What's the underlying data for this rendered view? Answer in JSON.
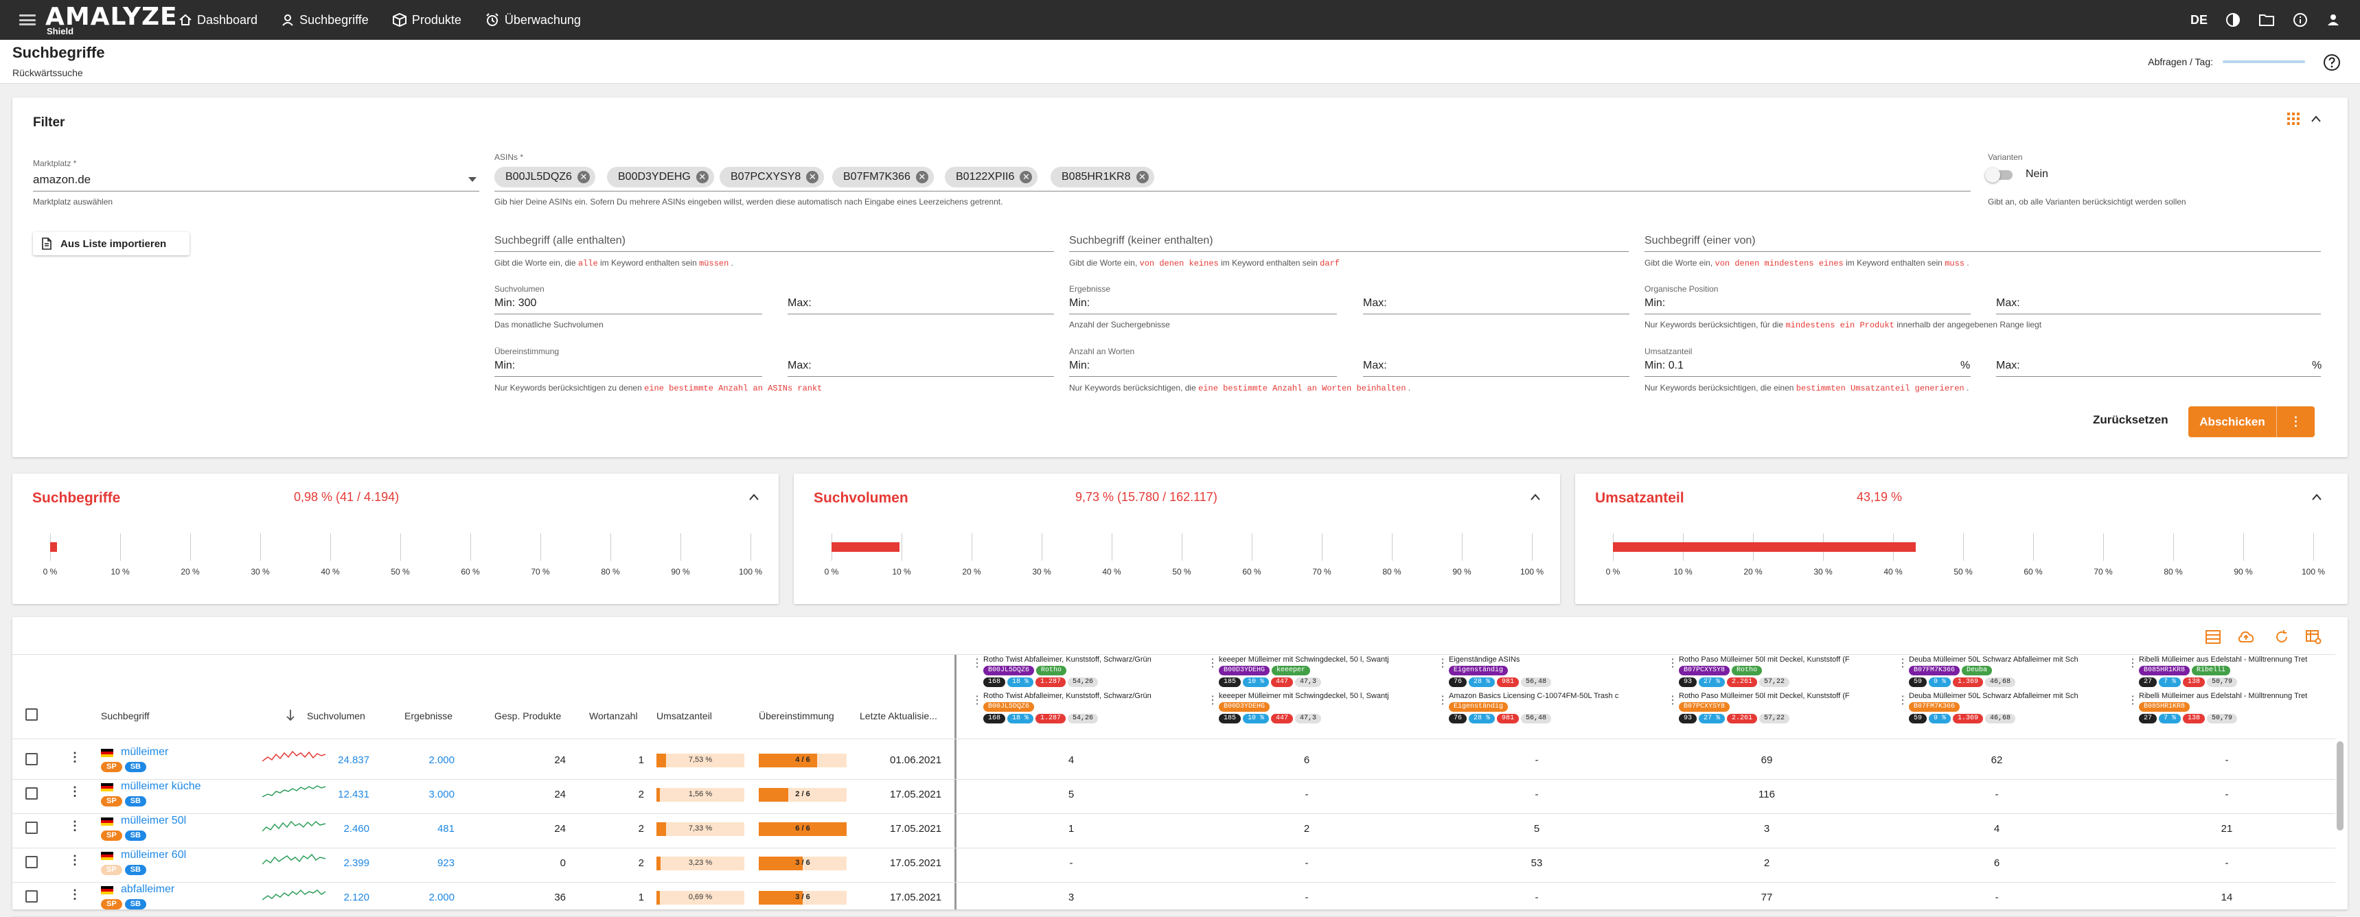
{
  "app": {
    "logo_main": "AMALYZE",
    "logo_sub": "Shield",
    "lang": "DE"
  },
  "nav": [
    {
      "label": "Dashboard",
      "icon": "home-icon"
    },
    {
      "label": "Suchbegriffe",
      "icon": "user-icon"
    },
    {
      "label": "Produkte",
      "icon": "box-icon"
    },
    {
      "label": "Überwachung",
      "icon": "alarm-icon"
    }
  ],
  "page": {
    "title": "Suchbegriffe",
    "subtitle": "Rückwärtssuche",
    "abfragen_label": "Abfragen / Tag:"
  },
  "filter": {
    "title": "Filter",
    "marketplace": {
      "label": "Marktplatz *",
      "value": "amazon.de",
      "hint": "Marktplatz auswählen"
    },
    "asins": {
      "label": "ASINs *",
      "chips": [
        "B00JL5DQZ6",
        "B00D3YDEHG",
        "B07PCXYSY8",
        "B07FM7K366",
        "B0122XPII6",
        "B085HR1KR8"
      ],
      "hint": "Gib hier Deine ASINs ein. Sofern Du mehrere ASINs eingeben willst, werden diese automatisch nach Eingabe eines Leerzeichens getrennt."
    },
    "variants": {
      "label": "Varianten",
      "value": "Nein",
      "hint": "Gibt an, ob alle Varianten berücksichtigt werden sollen"
    },
    "import_label": "Aus Liste importieren",
    "kw_all": {
      "placeholder": "Suchbegriff (alle enthalten)",
      "hint_a": "Gibt die Worte ein, die",
      "hint_b": "alle",
      "hint_c": "im Keyword enthalten sein",
      "hint_d": "müssen",
      "hint_e": "."
    },
    "kw_none": {
      "placeholder": "Suchbegriff (keiner enthalten)",
      "hint_a": "Gibt die Worte ein,",
      "hint_b": "von denen keines",
      "hint_c": "im Keyword enthalten sein",
      "hint_d": "darf",
      "hint_e": ""
    },
    "kw_any": {
      "placeholder": "Suchbegriff (einer von)",
      "hint_a": "Gibt die Worte ein,",
      "hint_b": "von denen mindestens eines",
      "hint_c": "im Keyword enthalten sein",
      "hint_d": "muss",
      "hint_e": "."
    },
    "suchvolumen": {
      "label": "Suchvolumen",
      "min_label": "Min:",
      "min_value": "300",
      "max_label": "Max:",
      "hint": "Das monatliche Suchvolumen"
    },
    "ergebnisse": {
      "label": "Ergebnisse",
      "min_label": "Min:",
      "max_label": "Max:",
      "hint": "Anzahl der Suchergebnisse"
    },
    "org_position": {
      "label": "Organische Position",
      "min_label": "Min:",
      "max_label": "Max:",
      "hint_a": "Nur Keywords berücksichtigen, für die",
      "hint_b": "mindestens ein Produkt",
      "hint_c": "innerhalb der angegebenen Range liegt"
    },
    "uebereinstimmung": {
      "label": "Übereinstimmung",
      "min_label": "Min:",
      "max_label": "Max:",
      "hint_a": "Nur Keywords berücksichtigen zu denen",
      "hint_b": "eine bestimmte Anzahl an ASINs rankt"
    },
    "anzahl_worte": {
      "label": "Anzahl an Worten",
      "min_label": "Min:",
      "max_label": "Max:",
      "hint_a": "Nur Keywords berücksichtigen, die",
      "hint_b": "eine bestimmte Anzahl an Worten beinhalten",
      "hint_c": "."
    },
    "umsatzanteil": {
      "label": "Umsatzanteil",
      "min_label": "Min:",
      "min_value": "0.1",
      "unit": "%",
      "max_label": "Max:",
      "hint_a": "Nur Keywords berücksichtigen, die einen",
      "hint_b": "bestimmten Umsatzanteil generieren",
      "hint_c": "."
    },
    "reset_label": "Zurücksetzen",
    "send_label": "Abschicken"
  },
  "stats": [
    {
      "title": "Suchbegriffe",
      "value": "0,98 % (41 / 4.194)",
      "pct": 0.98
    },
    {
      "title": "Suchvolumen",
      "value": "9,73 % (15.780 / 162.117)",
      "pct": 9.73
    },
    {
      "title": "Umsatzanteil",
      "value": "43,19 %",
      "pct": 43.19
    }
  ],
  "ticks": [
    "0 %",
    "10 %",
    "20 %",
    "30 %",
    "40 %",
    "50 %",
    "60 %",
    "70 %",
    "80 %",
    "90 %",
    "100 %"
  ],
  "table": {
    "headers": {
      "suchbegriff": "Suchbegriff",
      "suchvolumen": "Suchvolumen",
      "ergebnisse": "Ergebnisse",
      "gesp": "Gesp. Produkte",
      "wortanzahl": "Wortanzahl",
      "umsatzanteil": "Umsatzanteil",
      "uebereinstimmung": "Übereinstimmung",
      "letzte": "Letzte Aktualisie..."
    },
    "products": [
      {
        "t1": "Rotho Twist Abfalleimer, Kunststoff, Schwarz/Grün",
        "t2": "Rotho Twist Abfalleimer, Kunststoff, Schwarz/Grün",
        "chips1": [
          [
            "B00JL5DQZ6",
            "p"
          ],
          [
            "Rotho",
            "g"
          ]
        ],
        "chips2": [
          [
            "B00JL5DQZ6",
            "o"
          ]
        ],
        "nums": [
          "168",
          "18 %",
          "1.287",
          "54,26"
        ]
      },
      {
        "t1": "keeeper Mülleimer mit Schwingdeckel, 50 l, Swantj",
        "t2": "keeeper Mülleimer mit Schwingdeckel, 50 l, Swantj",
        "chips1": [
          [
            "B00D3YDEHG",
            "p"
          ],
          [
            "keeeper",
            "g"
          ]
        ],
        "chips2": [
          [
            "B00D3YDEHG",
            "o"
          ]
        ],
        "nums": [
          "185",
          "10 %",
          "447",
          "47,3"
        ]
      },
      {
        "t1": "Eigenständige ASINs",
        "t2": "Amazon Basics Licensing C-10074FM-50L Trash c",
        "chips1": [
          [
            "Eigenständig",
            "p"
          ]
        ],
        "chips2": [
          [
            "Eigenständig",
            "o"
          ]
        ],
        "nums": [
          "76",
          "28 %",
          "981",
          "56,48"
        ]
      },
      {
        "t1": "Rotho Paso Mülleimer 50l mit Deckel, Kunststoff (F",
        "t2": "Rotho Paso Mülleimer 50l mit Deckel, Kunststoff (F",
        "chips1": [
          [
            "B07PCXYSY8",
            "p"
          ],
          [
            "Rotho",
            "g"
          ]
        ],
        "chips2": [
          [
            "B07PCXYSY8",
            "o"
          ]
        ],
        "nums": [
          "93",
          "27 %",
          "2.261",
          "57,22"
        ]
      },
      {
        "t1": "Deuba Mülleimer 50L Schwarz Abfalleimer mit Sch",
        "t2": "Deuba Mülleimer 50L Schwarz Abfalleimer mit Sch",
        "chips1": [
          [
            "B07FM7K366",
            "p"
          ],
          [
            "Deuba",
            "g"
          ]
        ],
        "chips2": [
          [
            "B07FM7K366",
            "o"
          ]
        ],
        "nums": [
          "59",
          "9 %",
          "1.369",
          "46,68"
        ]
      },
      {
        "t1": "Ribelli Mülleimer aus Edelstahl - Mülltrennung Tret",
        "t2": "Ribelli Mülleimer aus Edelstahl - Mülltrennung Tret",
        "chips1": [
          [
            "B085HR1KR8",
            "p"
          ],
          [
            "Ribelli",
            "g"
          ]
        ],
        "chips2": [
          [
            "B085HR1KR8",
            "o"
          ]
        ],
        "nums": [
          "27",
          "7 %",
          "138",
          "50,79"
        ]
      }
    ],
    "rows": [
      {
        "keyword": "mülleimer",
        "sv": "24.837",
        "erg": "2.000",
        "gesp": "24",
        "worte": "1",
        "us": "7,53 %",
        "us_pct": 7.53,
        "ue": "4 / 6",
        "ue_frac": 0.667,
        "date": "01.06.2021",
        "sb_only": false,
        "cols": [
          "4",
          "6",
          "-",
          "69",
          "62",
          "-"
        ]
      },
      {
        "keyword": "mülleimer küche",
        "sv": "12.431",
        "erg": "3.000",
        "gesp": "24",
        "worte": "2",
        "us": "1,56 %",
        "us_pct": 1.56,
        "ue": "2 / 6",
        "ue_frac": 0.333,
        "date": "17.05.2021",
        "sb_only": false,
        "cols": [
          "5",
          "-",
          "-",
          "116",
          "-",
          "-"
        ]
      },
      {
        "keyword": "mülleimer 50l",
        "sv": "2.460",
        "erg": "481",
        "gesp": "24",
        "worte": "2",
        "us": "7,33 %",
        "us_pct": 7.33,
        "ue": "6 / 6",
        "ue_frac": 1.0,
        "date": "17.05.2021",
        "sb_only": false,
        "cols": [
          "1",
          "2",
          "5",
          "3",
          "4",
          "21"
        ]
      },
      {
        "keyword": "mülleimer 60l",
        "sv": "2.399",
        "erg": "923",
        "gesp": "0",
        "worte": "2",
        "us": "3,23 %",
        "us_pct": 3.23,
        "ue": "3 / 6",
        "ue_frac": 0.5,
        "date": "17.05.2021",
        "sb_only": true,
        "cols": [
          "-",
          "-",
          "53",
          "2",
          "6",
          "-"
        ]
      },
      {
        "keyword": "abfalleimer",
        "sv": "2.120",
        "erg": "2.000",
        "gesp": "36",
        "worte": "1",
        "us": "0,69 %",
        "us_pct": 0.69,
        "ue": "3 / 6",
        "ue_frac": 0.5,
        "date": "17.05.2021",
        "sb_only": false,
        "cols": [
          "3",
          "-",
          "-",
          "77",
          "-",
          "14"
        ]
      }
    ],
    "badge_sp": "SP",
    "badge_sb": "SB"
  },
  "colors": {
    "accent": "#f0821e",
    "red": "#e53935",
    "link": "#1e88e5"
  }
}
